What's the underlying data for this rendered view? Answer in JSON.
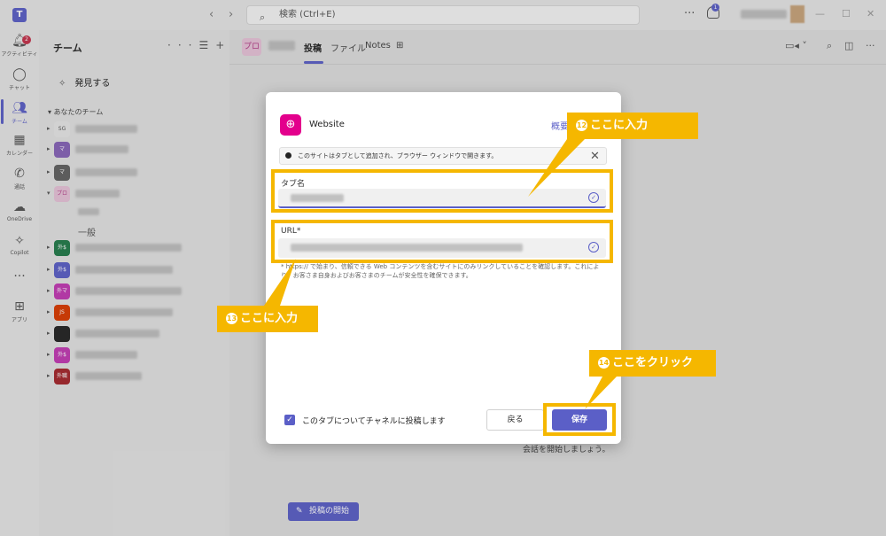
{
  "titlebar": {
    "search_placeholder": "検索 (Ctrl+E)",
    "notification_count": "1",
    "more": "···"
  },
  "rail": {
    "activity_label": "アクティビティ",
    "activity_badge": "2",
    "chat_label": "チャット",
    "teams_label": "チーム",
    "calendar_label": "カレンダー",
    "calls_label": "通話",
    "onedrive_label": "OneDrive",
    "copilot_label": "Copilot",
    "more": "···",
    "apps_label": "アプリ"
  },
  "teams_panel": {
    "title": "チーム",
    "discover": "発見する",
    "section": "あなたのチーム",
    "teams": [
      {
        "abbr": "SG",
        "color": "#e8e8e8"
      },
      {
        "abbr": "マ",
        "color": "#8764b8"
      },
      {
        "abbr": "マ",
        "color": "#616161"
      },
      {
        "abbr": "プロ",
        "color": "#e7c3d9"
      },
      {
        "abbr": "外$",
        "color": "#237b4b"
      },
      {
        "abbr": "外$",
        "color": "#5b5fc7"
      },
      {
        "abbr": "外マ",
        "color": "#c239b3"
      },
      {
        "abbr": "JS",
        "color": "#da3b01"
      },
      {
        "abbr": "",
        "color": "#242424"
      },
      {
        "abbr": "外$",
        "color": "#c239b3"
      },
      {
        "abbr": "外職",
        "color": "#a4262c"
      }
    ],
    "channel_general": "一般"
  },
  "main": {
    "team_abbr": "プロ",
    "tabs": [
      "投稿",
      "ファイル",
      "Notes"
    ],
    "conversation_text": "会話を開始しましょう。",
    "post_button": "投稿の開始"
  },
  "dialog": {
    "app_name": "Website",
    "about_link": "概要",
    "banner": "このサイトはタブとして追加され、ブラウザー ウィンドウで開きます。",
    "tab_name_label": "タブ名",
    "url_label": "URL*",
    "note": "* https:// で始まり、信頼できる Web コンテンツを含むサイトにのみリンクしていることを確認します。これにより、お客さま自身およびお客さまのチームが安全性を確保できます。",
    "post_checkbox_label": "このタブについてチャネルに投稿します",
    "back_button": "戻る",
    "save_button": "保存"
  },
  "annotations": [
    {
      "num": "12",
      "text": "ここに入力"
    },
    {
      "num": "13",
      "text": "ここに入力"
    },
    {
      "num": "14",
      "text": "ここをクリック"
    }
  ],
  "colors": {
    "accent": "#5b5fc7",
    "highlight": "#f5b700",
    "website_icon": "#e3008c"
  }
}
